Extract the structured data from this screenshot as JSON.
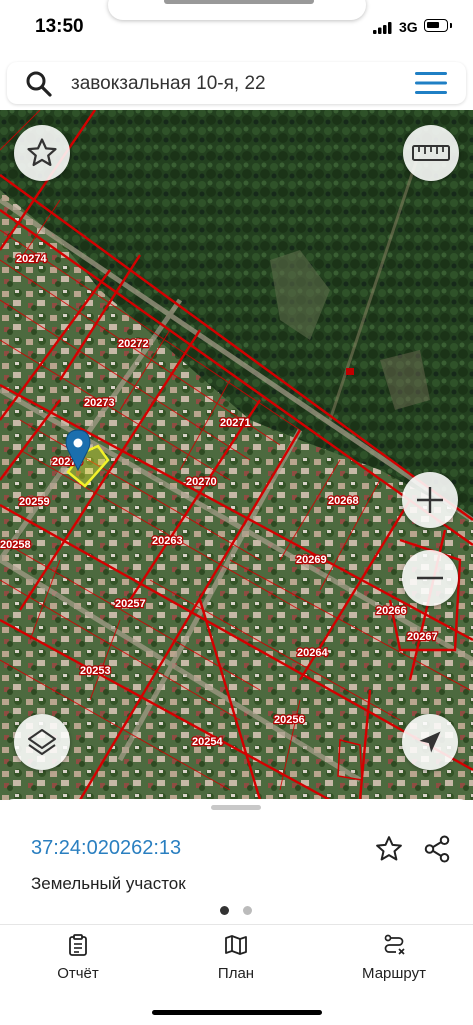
{
  "status_bar": {
    "time": "13:50",
    "network": "3G"
  },
  "search": {
    "query": "завокзальная 10-я, 22"
  },
  "map": {
    "plot_labels": [
      "20274",
      "20272",
      "20273",
      "20271",
      "20270",
      "20268",
      "20259",
      "20263",
      "20269",
      "20258",
      "20257",
      "20266",
      "20267",
      "20253",
      "20264",
      "20256",
      "20254",
      "20275"
    ],
    "marker_icon": "location-pin",
    "selected_parcel_color": "#f2f22a",
    "boundary_color": "#d40000"
  },
  "controls": {
    "favorite_icon": "star-outline",
    "ruler_icon": "ruler",
    "zoom_in_icon": "plus",
    "zoom_out_icon": "minus",
    "layers_icon": "layers",
    "locate_icon": "navigation-arrow"
  },
  "sheet": {
    "cad_number": "37:24:020262:13",
    "object_type": "Земельный участок",
    "page_count": 2,
    "active_page": 1
  },
  "tabs": [
    {
      "label": "Отчёт",
      "icon": "report-clipboard"
    },
    {
      "label": "План",
      "icon": "map-plan"
    },
    {
      "label": "Маршрут",
      "icon": "route"
    }
  ],
  "colors": {
    "accent": "#2a7fc0",
    "boundary": "#d40000"
  }
}
